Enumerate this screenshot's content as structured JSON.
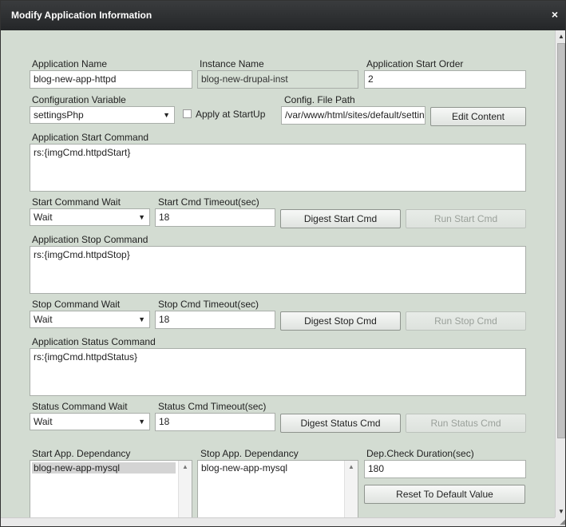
{
  "dialog": {
    "title": "Modify Application Information",
    "close_symbol": "×"
  },
  "form": {
    "app_name_label": "Application Name",
    "app_name_value": "blog-new-app-httpd",
    "instance_name_label": "Instance Name",
    "instance_name_value": "blog-new-drupal-inst",
    "start_order_label": "Application Start Order",
    "start_order_value": "2",
    "config_var_label": "Configuration Variable",
    "config_var_value": "settingsPhp",
    "apply_startup_label": "Apply at StartUp",
    "config_path_label": "Config. File Path",
    "config_path_value": "/var/www/html/sites/default/settings.php",
    "edit_content_button": "Edit Content",
    "start_cmd_label": "Application Start Command",
    "start_cmd_value": "rs:{imgCmd.httpdStart}",
    "start_wait_label": "Start Command Wait",
    "start_wait_value": "Wait",
    "start_timeout_label": "Start Cmd Timeout(sec)",
    "start_timeout_value": "18",
    "digest_start_button": "Digest Start Cmd",
    "run_start_button": "Run Start Cmd",
    "stop_cmd_label": "Application Stop Command",
    "stop_cmd_value": "rs:{imgCmd.httpdStop}",
    "stop_wait_label": "Stop Command Wait",
    "stop_wait_value": "Wait",
    "stop_timeout_label": "Stop Cmd Timeout(sec)",
    "stop_timeout_value": "18",
    "digest_stop_button": "Digest Stop Cmd",
    "run_stop_button": "Run Stop Cmd",
    "status_cmd_label": "Application Status Command",
    "status_cmd_value": "rs:{imgCmd.httpdStatus}",
    "status_wait_label": "Status Command Wait",
    "status_wait_value": "Wait",
    "status_timeout_label": "Status Cmd Timeout(sec)",
    "status_timeout_value": "18",
    "digest_status_button": "Digest Status Cmd",
    "run_status_button": "Run Status Cmd",
    "start_dep_label": "Start App. Dependancy",
    "start_dep_items": [
      "blog-new-app-mysql"
    ],
    "stop_dep_label": "Stop App. Dependancy",
    "stop_dep_items": [
      "blog-new-app-mysql"
    ],
    "dep_check_label": "Dep.Check Duration(sec)",
    "dep_check_value": "180",
    "reset_button": "Reset To Default Value"
  },
  "icons": {
    "dropdown_arrow": "▼",
    "scroll_up": "▲",
    "scroll_down": "▼",
    "resize_grip": "◢"
  }
}
